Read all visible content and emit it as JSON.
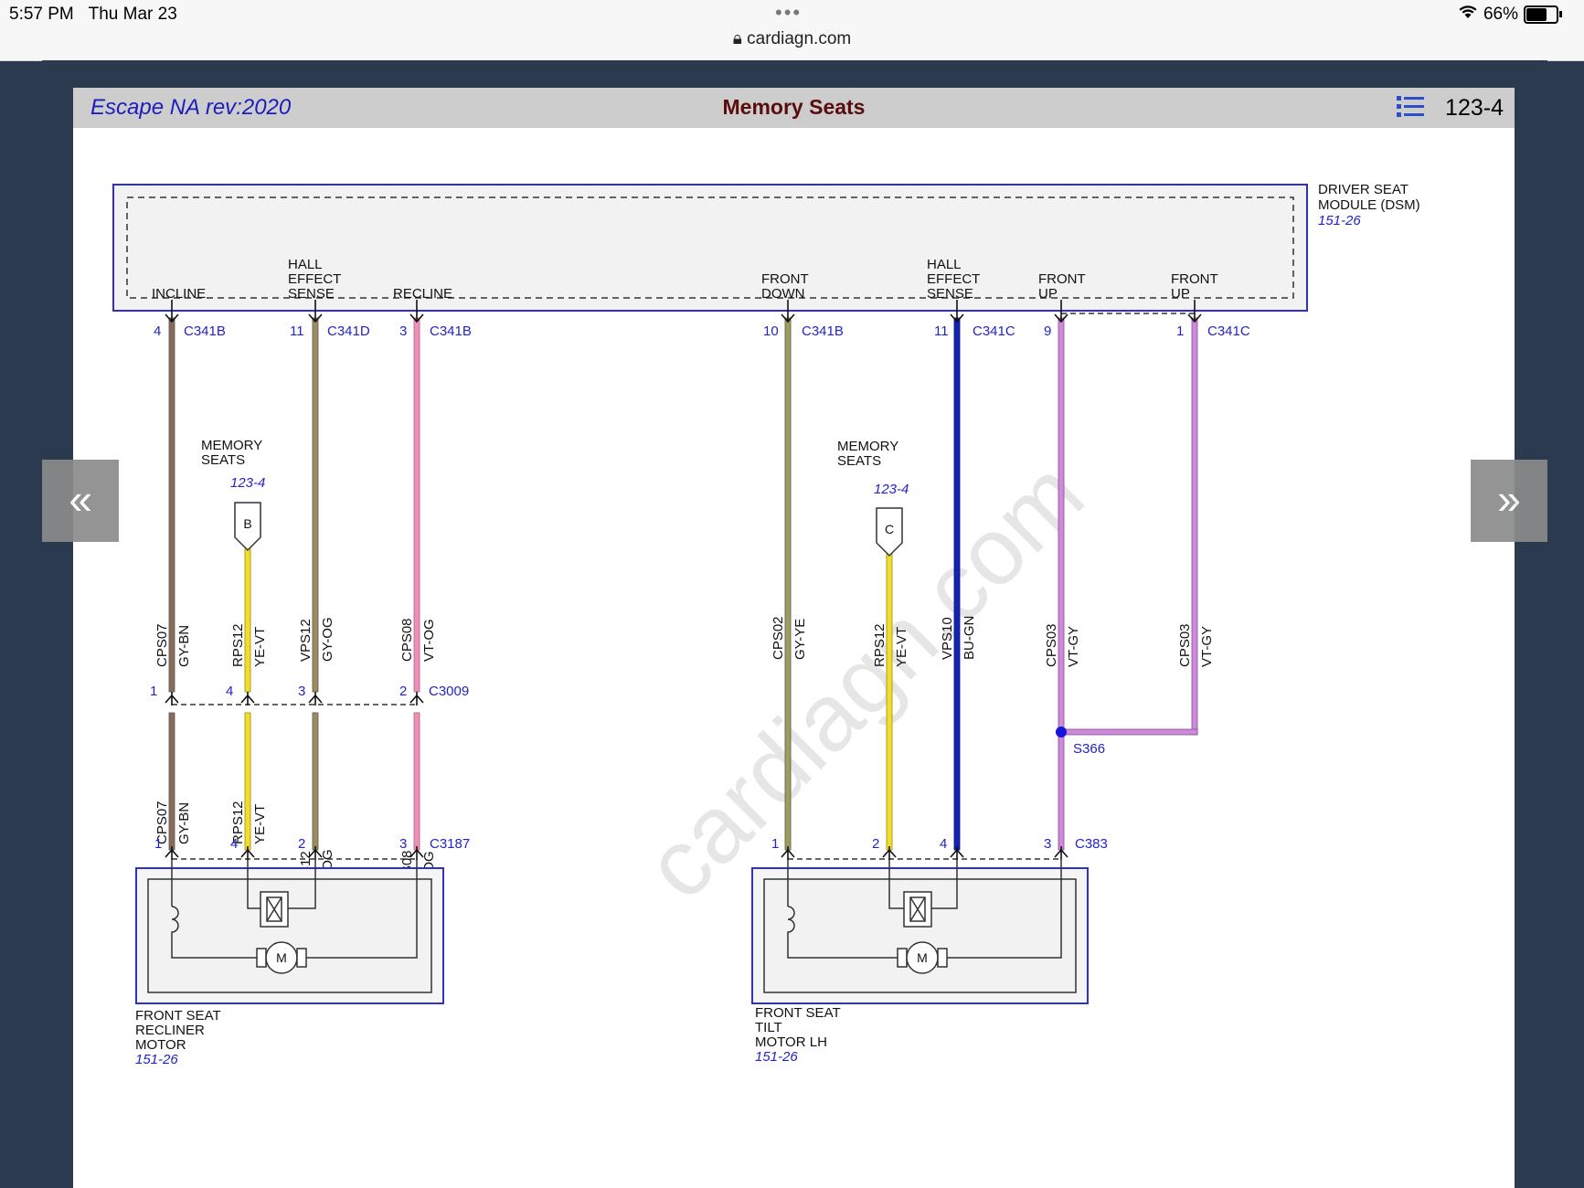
{
  "status_bar": {
    "time": "5:57 PM",
    "date": "Thu Mar 23",
    "url": "cardiagn.com",
    "battery": "66%"
  },
  "header": {
    "model": "Escape NA rev:2020",
    "title": "Memory Seats",
    "page": "123-4"
  },
  "watermark": "cardiagn.com",
  "dsm": {
    "lines": [
      "DRIVER SEAT",
      "MODULE (DSM)"
    ],
    "ref": "151-26"
  },
  "pins": {
    "incline": [
      "INCLINE"
    ],
    "hall1": [
      "HALL",
      "EFFECT",
      "SENSE"
    ],
    "recline": [
      "RECLINE"
    ],
    "front_down": [
      "FRONT",
      "DOWN"
    ],
    "hall2": [
      "HALL",
      "EFFECT",
      "SENSE"
    ],
    "front_up1": [
      "FRONT",
      "UP"
    ],
    "front_up2": [
      "FRONT",
      "UP"
    ]
  },
  "dsm_connectors": [
    {
      "pin": "4",
      "conn": "C341B"
    },
    {
      "pin": "11",
      "conn": "C341D"
    },
    {
      "pin": "3",
      "conn": "C341B"
    },
    {
      "pin": "10",
      "conn": "C341B"
    },
    {
      "pin": "11",
      "conn": "C341C"
    },
    {
      "pin": "9",
      "conn": ""
    },
    {
      "pin": "1",
      "conn": "C341C"
    }
  ],
  "wires": [
    {
      "circuit": "CPS07",
      "color": "GY-BN"
    },
    {
      "circuit": "RPS12",
      "color": "YE-VT"
    },
    {
      "circuit": "VPS12",
      "color": "GY-OG"
    },
    {
      "circuit": "CPS08",
      "color": "VT-OG"
    },
    {
      "circuit": "CPS02",
      "color": "GY-YE"
    },
    {
      "circuit": "RPS12",
      "color": "YE-VT"
    },
    {
      "circuit": "VPS10",
      "color": "BU-GN"
    },
    {
      "circuit": "CPS03",
      "color": "VT-GY"
    },
    {
      "circuit": "CPS03",
      "color": "VT-GY"
    }
  ],
  "wire_hex": {
    "gy_bn": "#8a6a5a",
    "ye_vt": "#f2dd2a",
    "gy_og": "#9c8c5e",
    "vt_og": "#f08fb8",
    "gy_ye": "#9aa05c",
    "bu_gn": "#1226b6",
    "vt_gy": "#cc8ad8"
  },
  "refs": [
    {
      "lines": [
        "MEMORY",
        "SEATS"
      ],
      "page": "123-4",
      "letter": "B"
    },
    {
      "lines": [
        "MEMORY",
        "SEATS"
      ],
      "page": "123-4",
      "letter": "C"
    }
  ],
  "c3009": {
    "conn": "C3009",
    "pins": [
      "1",
      "4",
      "3",
      "2"
    ]
  },
  "c3187": {
    "conn": "C3187",
    "pins": [
      "1",
      "4",
      "2",
      "3"
    ]
  },
  "c383": {
    "conn": "C383",
    "pins": [
      "1",
      "2",
      "4",
      "3"
    ]
  },
  "splice": "S366",
  "motor_symbol": "M",
  "components": [
    {
      "lines": [
        "FRONT SEAT",
        "RECLINER",
        "MOTOR"
      ],
      "ref": "151-26"
    },
    {
      "lines": [
        "FRONT SEAT",
        "TILT",
        "MOTOR LH"
      ],
      "ref": "151-26"
    }
  ],
  "nav": {
    "prev_icon": "«",
    "next_icon": "»"
  }
}
